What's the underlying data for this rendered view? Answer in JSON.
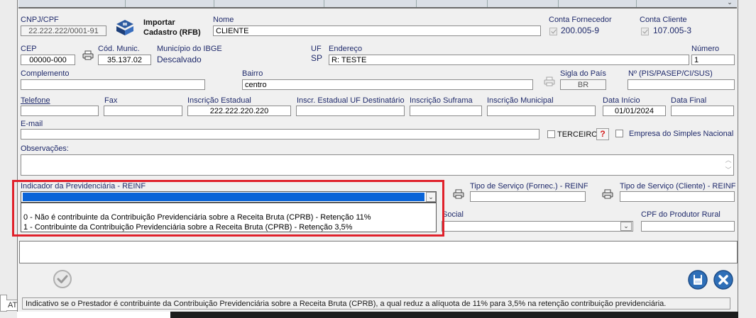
{
  "cnpj": {
    "label": "CNPJ/CPF",
    "value": "22.222.222/0001-91"
  },
  "rfb": {
    "line1": "Importar",
    "line2": "Cadastro (RFB)"
  },
  "nome": {
    "label": "Nome",
    "value": "CLIENTE"
  },
  "conta_fornecedor": {
    "label": "Conta Fornecedor",
    "value": "200.005-9"
  },
  "conta_cliente": {
    "label": "Conta Cliente",
    "value": "107.005-3"
  },
  "cep": {
    "label": "CEP",
    "value": "00000-000"
  },
  "cod_munic": {
    "label": "Cód. Munic.",
    "value": "35.137.02"
  },
  "municipio": {
    "label": "Município do IBGE",
    "value": "Descalvado"
  },
  "uf": {
    "label": "UF",
    "value": "SP"
  },
  "endereco": {
    "label": "Endereço",
    "value": "R: TESTE"
  },
  "numero": {
    "label": "Número",
    "value": "1"
  },
  "complemento": {
    "label": "Complemento",
    "value": ""
  },
  "bairro": {
    "label": "Bairro",
    "value": "centro"
  },
  "sigla_pais": {
    "label": "Sigla do País",
    "value": "BR"
  },
  "pis": {
    "label": "Nº (PIS/PASEP/CI/SUS)",
    "value": ""
  },
  "telefone": {
    "label": "Telefone",
    "value": ""
  },
  "fax": {
    "label": "Fax",
    "value": ""
  },
  "ie": {
    "label": "Inscrição Estadual",
    "value": "222.222.220.220"
  },
  "ie_dest": {
    "label": "Inscr. Estadual UF Destinatário",
    "value": ""
  },
  "suframa": {
    "label": "Inscrição Suframa",
    "value": ""
  },
  "im": {
    "label": "Inscrição Municipal",
    "value": ""
  },
  "data_inicio": {
    "label": "Data Início",
    "value": "01/01/2024"
  },
  "data_final": {
    "label": "Data Final",
    "value": ""
  },
  "email": {
    "label": "E-mail",
    "value": ""
  },
  "terceiro": {
    "label": "TERCEIRO"
  },
  "help": {
    "label": "?"
  },
  "simples": {
    "label": "Empresa do Simples Nacional"
  },
  "observacoes": {
    "label": "Observações:",
    "value": ""
  },
  "prev": {
    "label": "Indicador da Previdenciária - REINF",
    "selected": "",
    "options": [
      "0 - Não é contribuinte da Contribuição Previdenciária sobre a Receita Bruta (CPRB) - Retenção 11%",
      "1 - Contribuinte da Contribuição Previdenciária sobre a Receita Bruta (CPRB) - Retenção 3,5%"
    ]
  },
  "tipo_serv_fornec": {
    "label": "Tipo de Serviço (Fornec.) - REINF",
    "value": ""
  },
  "tipo_serv_cliente": {
    "label": "Tipo de Serviço (Cliente) - REINF",
    "value": ""
  },
  "social": {
    "label": "Social"
  },
  "cpf_produtor": {
    "label": "CPF do Produtor Rural",
    "value": ""
  },
  "status_hint": "Indicativo se o Prestador é contribuinte da Contribuição Previdenciária sobre a Receita Bruta (CPRB), a qual reduz a alíquota de 11% para 3,5% na retenção contribuição previdenciária.",
  "left_edge_text": "AT",
  "colors": {
    "label": "#1f2a6b",
    "highlight": "#e0212b",
    "selection": "#0a64d8",
    "button_blue": "#2e6fb8"
  },
  "icons": [
    "printer-icon",
    "rfb-logo-icon",
    "help-icon",
    "save-icon",
    "close-icon",
    "confirm-icon",
    "chevron-down-icon",
    "scroll-up-icon",
    "scroll-down-icon"
  ]
}
